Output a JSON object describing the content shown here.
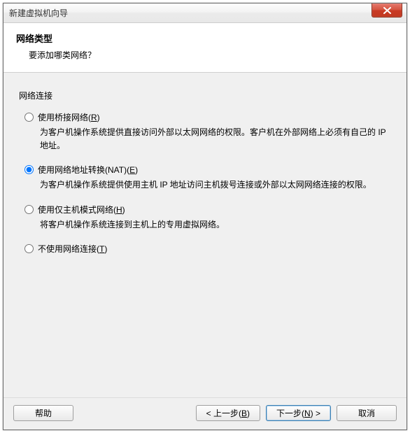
{
  "window": {
    "title": "新建虚拟机向导"
  },
  "header": {
    "title": "网络类型",
    "subtitle": "要添加哪类网络？"
  },
  "group": {
    "label": "网络连接"
  },
  "options": {
    "bridged": {
      "label_pre": "使用桥接网络(",
      "hotkey": "R",
      "label_post": ")",
      "desc": "为客户机操作系统提供直接访问外部以太网网络的权限。客户机在外部网络上必须有自己的 IP 地址。"
    },
    "nat": {
      "label_pre": "使用网络地址转换(NAT)(",
      "hotkey": "E",
      "label_post": ")",
      "desc": "为客户机操作系统提供使用主机 IP 地址访问主机拨号连接或外部以太网网络连接的权限。"
    },
    "hostonly": {
      "label_pre": "使用仅主机模式网络(",
      "hotkey": "H",
      "label_post": ")",
      "desc": "将客户机操作系统连接到主机上的专用虚拟网络。"
    },
    "none": {
      "label_pre": "不使用网络连接(",
      "hotkey": "T",
      "label_post": ")"
    }
  },
  "buttons": {
    "help": "帮助",
    "back_pre": "< 上一步(",
    "back_hotkey": "B",
    "back_post": ")",
    "next_pre": "下一步(",
    "next_hotkey": "N",
    "next_post": ") >",
    "cancel": "取消"
  }
}
